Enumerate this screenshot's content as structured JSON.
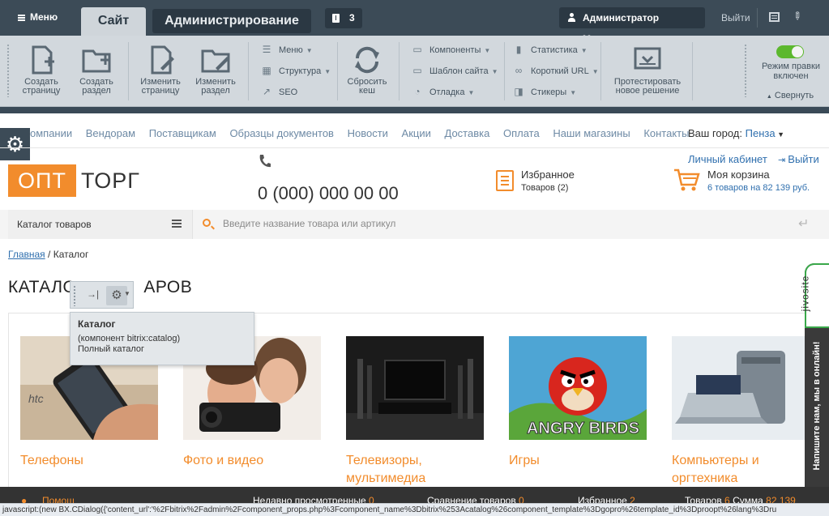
{
  "admin": {
    "menu_label": "Меню",
    "tab_site": "Сайт",
    "tab_admin": "Администрирование",
    "notifications_count": "3",
    "user_label": "Администратор Магазина",
    "logout_label": "Выйти",
    "buttons": {
      "create_page": "Создать страницу",
      "create_section": "Создать раздел",
      "edit_page": "Изменить страницу",
      "edit_section": "Изменить раздел",
      "reset_cache": "Сбросить кеш",
      "test_solution": "Протестировать новое решение"
    },
    "menu_list_1": [
      "Меню",
      "Структура",
      "SEO"
    ],
    "menu_list_2": [
      "Компоненты",
      "Шаблон сайта",
      "Отладка"
    ],
    "menu_list_3": [
      "Статистика",
      "Короткий URL",
      "Стикеры"
    ],
    "edit_mode_label": "Режим правки включен",
    "edit_mode_on": true,
    "collapse_label": "Свернуть"
  },
  "site": {
    "top_nav": [
      "омпании",
      "Вендорам",
      "Поставщикам",
      "Образцы документов",
      "Новости",
      "Акции",
      "Доставка",
      "Оплата",
      "Наши магазины",
      "Контакты"
    ],
    "city_label": "Ваш город:",
    "city_value": "Пенза",
    "cabinet_label": "Личный кабинет",
    "logout_label": "Выйти",
    "logo_left": "ОПТ",
    "logo_right": "ТОРГ",
    "phone": "0 (000) 000 00 00",
    "favorites_title": "Избранное",
    "favorites_sub": "Товаров (2)",
    "cart_title": "Моя корзина",
    "cart_sub": "6 товаров на 82 139 руб.",
    "catalog_dropdown": "Каталог товаров",
    "search_placeholder": "Введите название товара или артикул",
    "breadcrumb_home": "Главная",
    "breadcrumb_sep": " / ",
    "breadcrumb_current": "Каталог",
    "page_title_left": "КАТАЛО",
    "page_title_right": "АРОВ",
    "categories": [
      {
        "name": "Телефоны"
      },
      {
        "name": "Фото и видео"
      },
      {
        "name": "Телевизоры, мультимедиа"
      },
      {
        "name": "Игры"
      },
      {
        "name": "Компьютеры и оргтехника"
      }
    ],
    "tooltip": {
      "title": "Каталог",
      "line1": "(компонент bitrix:catalog)",
      "line2": "Полный каталог"
    },
    "jivo_brand": "jivosite",
    "jivo_text": "Напишите нам, мы в онлайн!",
    "bottom_bar": {
      "help": "Помощ",
      "recent": "Недавно просмотренные",
      "recent_count": "0",
      "compare": "Сравнение товаров",
      "compare_count": "0",
      "favorites": "Избранное",
      "favorites_count": "2",
      "cart": "Товаров",
      "cart_count": "6",
      "sum_label": "Сумма",
      "sum_value": "82 139"
    },
    "status_url": "javascript:(new BX.CDialog({'content_url':'%2Fbitrix%2Fadmin%2Fcomponent_props.php%3Fcomponent_name%3Dbitrix%253Acatalog%26component_template%3Dgopro%26template_id%3Dproopt%26lang%3Dru"
  },
  "colors": {
    "accent": "#f28c2c",
    "admin_dark": "#3c4b57",
    "link": "#2f6fae",
    "toggle_on": "#5cb82e"
  }
}
